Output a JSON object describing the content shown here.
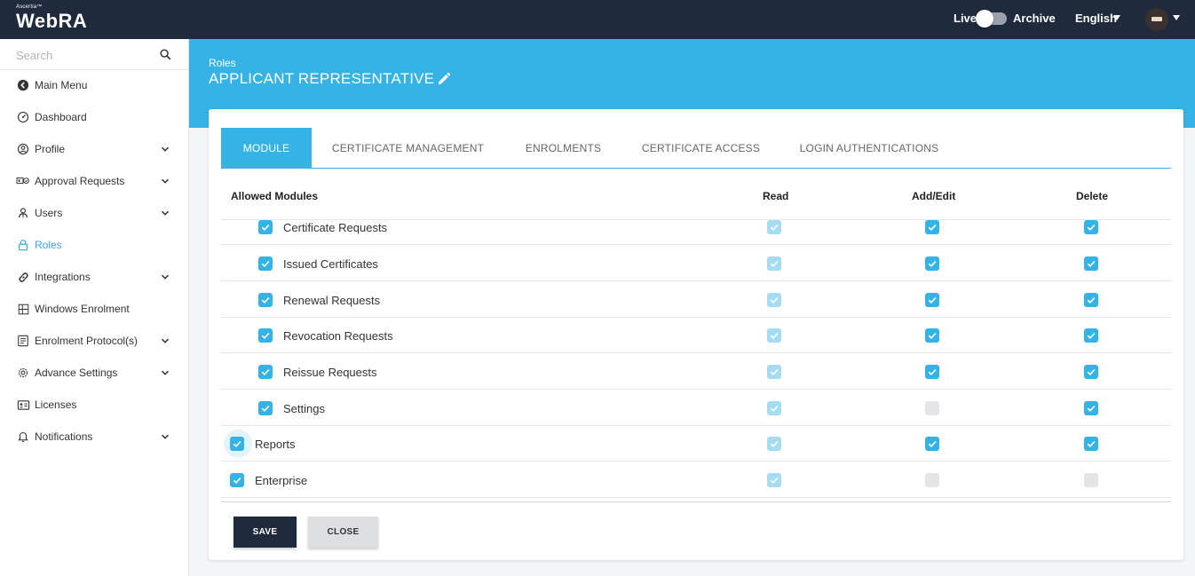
{
  "topbar": {
    "brand_small": "Ascertia™",
    "brand_name": "WebRA",
    "live_label": "Live",
    "archive_label": "Archive",
    "language": "English",
    "toggle_on": false
  },
  "sidebar": {
    "search_placeholder": "Search",
    "items": [
      {
        "label": "Main Menu",
        "icon": "back-circle-icon",
        "has_chevron": false
      },
      {
        "label": "Dashboard",
        "icon": "dashboard-icon",
        "has_chevron": false
      },
      {
        "label": "Profile",
        "icon": "profile-icon",
        "has_chevron": true
      },
      {
        "label": "Approval Requests",
        "icon": "approval-icon",
        "has_chevron": true
      },
      {
        "label": "Users",
        "icon": "users-icon",
        "has_chevron": true
      },
      {
        "label": "Roles",
        "icon": "lock-icon",
        "has_chevron": false,
        "active": true
      },
      {
        "label": "Integrations",
        "icon": "link-icon",
        "has_chevron": true
      },
      {
        "label": "Windows Enrolment",
        "icon": "windows-icon",
        "has_chevron": false
      },
      {
        "label": "Enrolment Protocol(s)",
        "icon": "protocol-icon",
        "has_chevron": true
      },
      {
        "label": "Advance Settings",
        "icon": "gear-icon",
        "has_chevron": true
      },
      {
        "label": "Licenses",
        "icon": "license-icon",
        "has_chevron": false
      },
      {
        "label": "Notifications",
        "icon": "bell-icon",
        "has_chevron": true
      }
    ]
  },
  "header": {
    "breadcrumb": "Roles",
    "title": "APPLICANT REPRESENTATIVE"
  },
  "tabs": [
    "MODULE",
    "CERTIFICATE MANAGEMENT",
    "ENROLMENTS",
    "CERTIFICATE ACCESS",
    "LOGIN AUTHENTICATIONS"
  ],
  "active_tab": 0,
  "table": {
    "headers": {
      "module": "Allowed Modules",
      "read": "Read",
      "add_edit": "Add/Edit",
      "delete": "Delete"
    },
    "rows": [
      {
        "label": "Certificate Requests",
        "indent": true,
        "allowed": "on",
        "read": "light",
        "add_edit": "on",
        "delete": "on"
      },
      {
        "label": "Issued Certificates",
        "indent": true,
        "allowed": "on",
        "read": "light",
        "add_edit": "on",
        "delete": "on"
      },
      {
        "label": "Renewal Requests",
        "indent": true,
        "allowed": "on",
        "read": "light",
        "add_edit": "on",
        "delete": "on"
      },
      {
        "label": "Revocation Requests",
        "indent": true,
        "allowed": "on",
        "read": "light",
        "add_edit": "on",
        "delete": "on"
      },
      {
        "label": "Reissue Requests",
        "indent": true,
        "allowed": "on",
        "read": "light",
        "add_edit": "on",
        "delete": "on"
      },
      {
        "label": "Settings",
        "indent": true,
        "allowed": "on",
        "read": "light",
        "add_edit": "off",
        "delete": "on"
      },
      {
        "label": "Reports",
        "indent": false,
        "allowed": "on",
        "read": "light",
        "add_edit": "on",
        "delete": "on"
      },
      {
        "label": "Enterprise",
        "indent": false,
        "allowed": "on",
        "read": "light",
        "add_edit": "off",
        "delete": "off"
      }
    ]
  },
  "buttons": {
    "save": "SAVE",
    "close": "CLOSE"
  },
  "colors": {
    "accent": "#35b3e4",
    "topbar": "#1f2a3c",
    "checkbox_light": "#a6dcf2",
    "checkbox_off": "#e4e5e7"
  }
}
